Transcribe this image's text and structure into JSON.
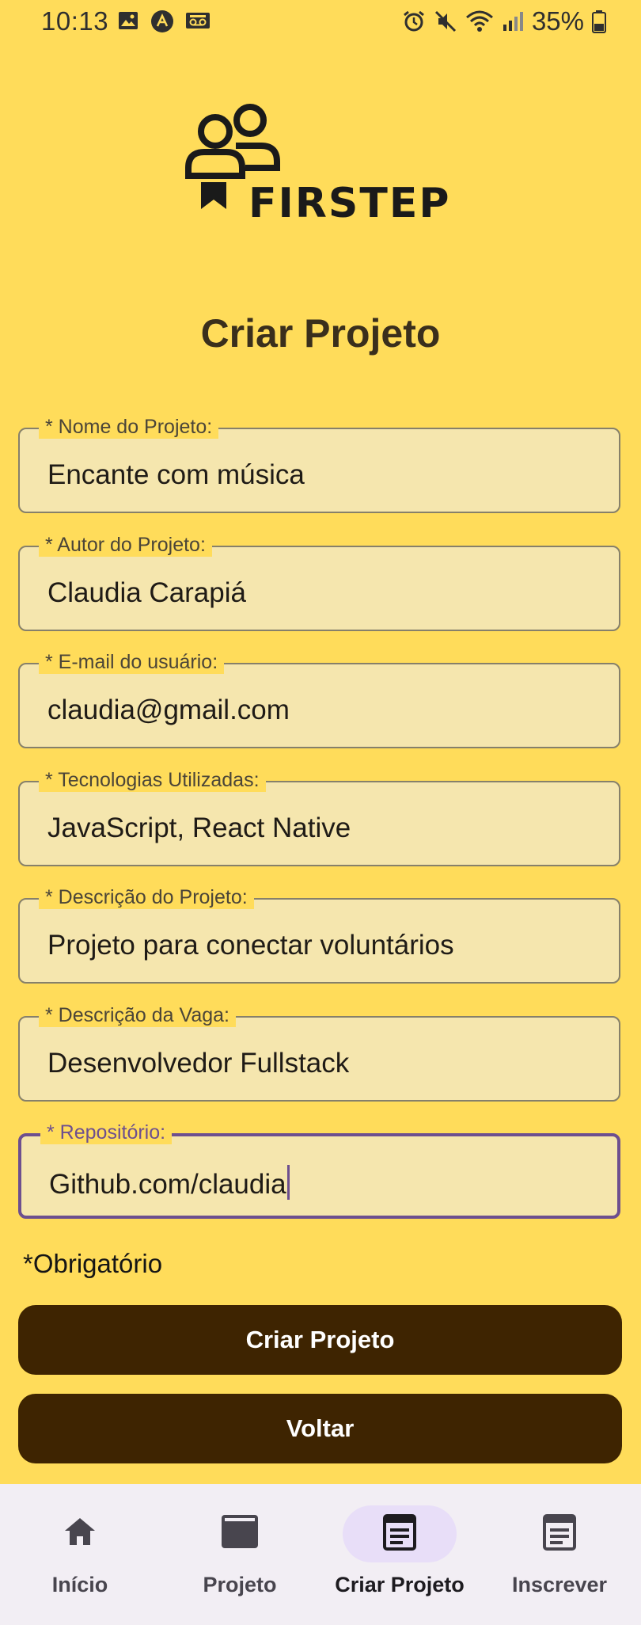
{
  "status_bar": {
    "time": "10:13",
    "battery": "35%",
    "left_icons": [
      "image-icon",
      "app-icon",
      "voicemail-icon"
    ],
    "right_icons": [
      "alarm-icon",
      "mute-icon",
      "wifi-icon",
      "signal-icon",
      "battery-icon"
    ]
  },
  "logo": {
    "text": "FIRSTEP"
  },
  "page": {
    "title": "Criar Projeto"
  },
  "form": {
    "fields": [
      {
        "label": "* Nome do Projeto:",
        "value": "Encante com música"
      },
      {
        "label": "* Autor do Projeto:",
        "value": "Claudia Carapiá"
      },
      {
        "label": "* E-mail do usuário:",
        "value": "claudia@gmail.com"
      },
      {
        "label": "* Tecnologias Utilizadas:",
        "value": "JavaScript, React Native"
      },
      {
        "label": "* Descrição do Projeto:",
        "value": "Projeto para conectar voluntários"
      },
      {
        "label": "* Descrição da Vaga:",
        "value": "Desenvolvedor Fullstack"
      },
      {
        "label": "* Repositório:",
        "value": "Github.com/claudia"
      }
    ],
    "required_note": "*Obrigatório",
    "submit_label": "Criar Projeto",
    "back_label": "Voltar"
  },
  "nav": {
    "items": [
      {
        "label": "Início",
        "icon": "home-icon"
      },
      {
        "label": "Projeto",
        "icon": "window-icon"
      },
      {
        "label": "Criar Projeto",
        "icon": "document-icon",
        "active": true
      },
      {
        "label": "Inscrever",
        "icon": "document-icon"
      }
    ]
  },
  "colors": {
    "background": "#FFDC5A",
    "button": "#3E2401",
    "focus": "#6d4f8f",
    "field_fill": "#F5E6AE"
  }
}
